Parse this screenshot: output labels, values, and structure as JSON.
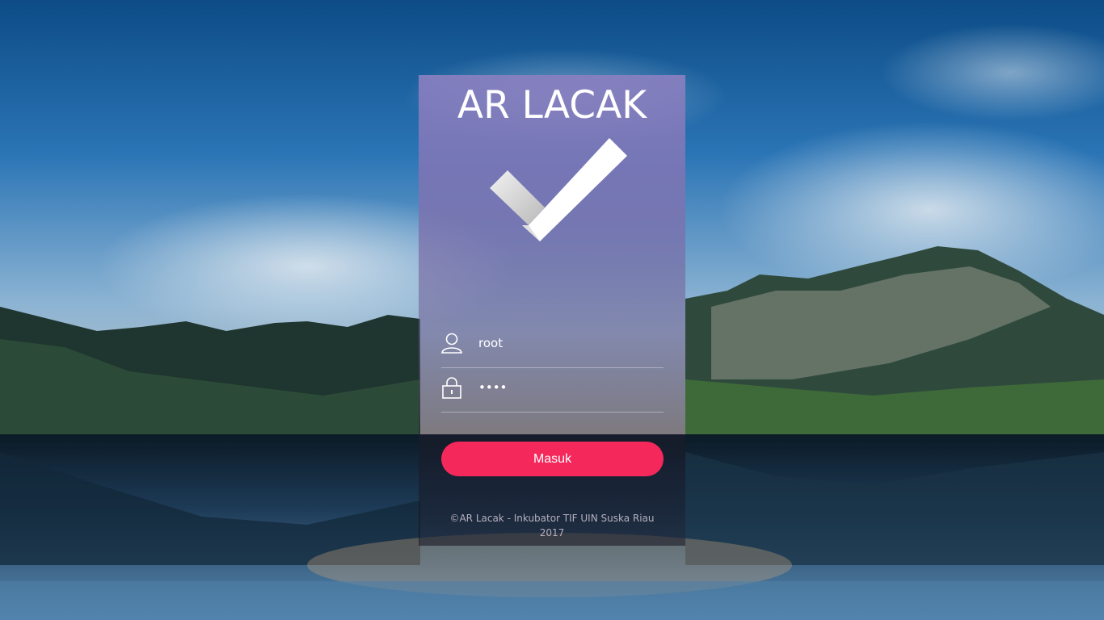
{
  "app": {
    "title": "AR LACAK",
    "logo_icon": "checkmark-icon"
  },
  "form": {
    "username": {
      "icon": "user-icon",
      "value": "root"
    },
    "password": {
      "icon": "lock-icon",
      "value": "••••"
    },
    "submit_label": "Masuk"
  },
  "footer": {
    "line1": "©AR Lacak - Inkubator TIF UIN Suska Riau",
    "line2": "2017"
  },
  "colors": {
    "accent": "#f5285c",
    "title_text": "#ffffff",
    "footer_text": "#b5b0bd"
  }
}
